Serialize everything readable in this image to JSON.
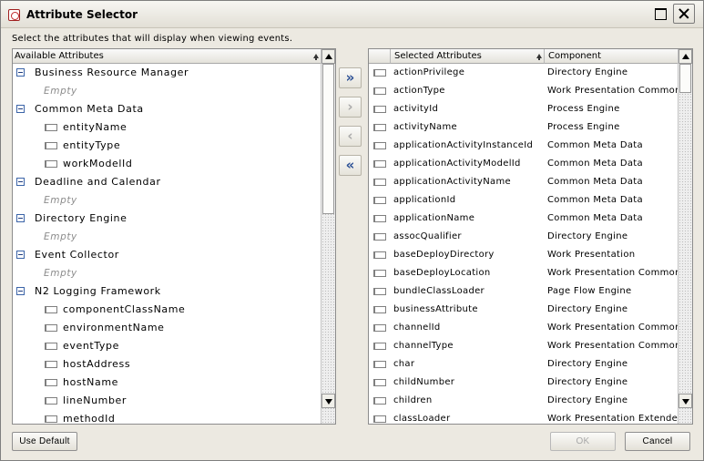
{
  "window": {
    "title": "Attribute Selector"
  },
  "instructions": "Select the attributes that will display when viewing events.",
  "available": {
    "header": "Available Attributes",
    "rows": [
      {
        "kind": "group",
        "label": "Business Resource Manager"
      },
      {
        "kind": "empty",
        "label": "Empty"
      },
      {
        "kind": "group",
        "label": "Common Meta Data"
      },
      {
        "kind": "leaf",
        "label": "entityName"
      },
      {
        "kind": "leaf",
        "label": "entityType"
      },
      {
        "kind": "leaf",
        "label": "workModelId"
      },
      {
        "kind": "group",
        "label": "Deadline and Calendar"
      },
      {
        "kind": "empty",
        "label": "Empty"
      },
      {
        "kind": "group",
        "label": "Directory Engine"
      },
      {
        "kind": "empty",
        "label": "Empty"
      },
      {
        "kind": "group",
        "label": "Event Collector"
      },
      {
        "kind": "empty",
        "label": "Empty"
      },
      {
        "kind": "group",
        "label": "N2 Logging Framework"
      },
      {
        "kind": "leaf",
        "label": "componentClassName"
      },
      {
        "kind": "leaf",
        "label": "environmentName"
      },
      {
        "kind": "leaf",
        "label": "eventType"
      },
      {
        "kind": "leaf",
        "label": "hostAddress"
      },
      {
        "kind": "leaf",
        "label": "hostName"
      },
      {
        "kind": "leaf",
        "label": "lineNumber"
      },
      {
        "kind": "leaf",
        "label": "methodId"
      }
    ]
  },
  "selected": {
    "header_attr": "Selected Attributes",
    "header_comp": "Component",
    "rows": [
      {
        "attr": "actionPrivilege",
        "comp": "Directory Engine"
      },
      {
        "attr": "actionType",
        "comp": "Work Presentation Common"
      },
      {
        "attr": "activityId",
        "comp": "Process Engine"
      },
      {
        "attr": "activityName",
        "comp": "Process Engine"
      },
      {
        "attr": "applicationActivityInstanceId",
        "comp": "Common Meta Data"
      },
      {
        "attr": "applicationActivityModelId",
        "comp": "Common Meta Data"
      },
      {
        "attr": "applicationActivityName",
        "comp": "Common Meta Data"
      },
      {
        "attr": "applicationId",
        "comp": "Common Meta Data"
      },
      {
        "attr": "applicationName",
        "comp": "Common Meta Data"
      },
      {
        "attr": "assocQualifier",
        "comp": "Directory Engine"
      },
      {
        "attr": "baseDeployDirectory",
        "comp": "Work Presentation"
      },
      {
        "attr": "baseDeployLocation",
        "comp": "Work Presentation Common"
      },
      {
        "attr": "bundleClassLoader",
        "comp": "Page Flow Engine"
      },
      {
        "attr": "businessAttribute",
        "comp": "Directory Engine"
      },
      {
        "attr": "channelId",
        "comp": "Work Presentation Common"
      },
      {
        "attr": "channelType",
        "comp": "Work Presentation Common"
      },
      {
        "attr": "char",
        "comp": "Directory Engine"
      },
      {
        "attr": "childNumber",
        "comp": "Directory Engine"
      },
      {
        "attr": "children",
        "comp": "Directory Engine"
      },
      {
        "attr": "classLoader",
        "comp": "Work Presentation Extender Cc"
      }
    ]
  },
  "transfer": {
    "add_all": "»",
    "add_one": "›",
    "remove_one": "‹",
    "remove_all": "«"
  },
  "buttons": {
    "use_default": "Use Default",
    "ok": "OK",
    "cancel": "Cancel"
  },
  "icons": {
    "app": "app-icon",
    "maximize": "maximize-icon",
    "close": "close-icon",
    "collapse": "collapse-icon",
    "leaf": "attribute-icon",
    "sort": "sort-ascending-icon"
  },
  "colors": {
    "background": "#ece9e1",
    "panel": "#ffffff",
    "transfer_active": "#2a4f95",
    "disabled_text": "#aaaaaa",
    "empty_text": "#8c8c8c"
  }
}
